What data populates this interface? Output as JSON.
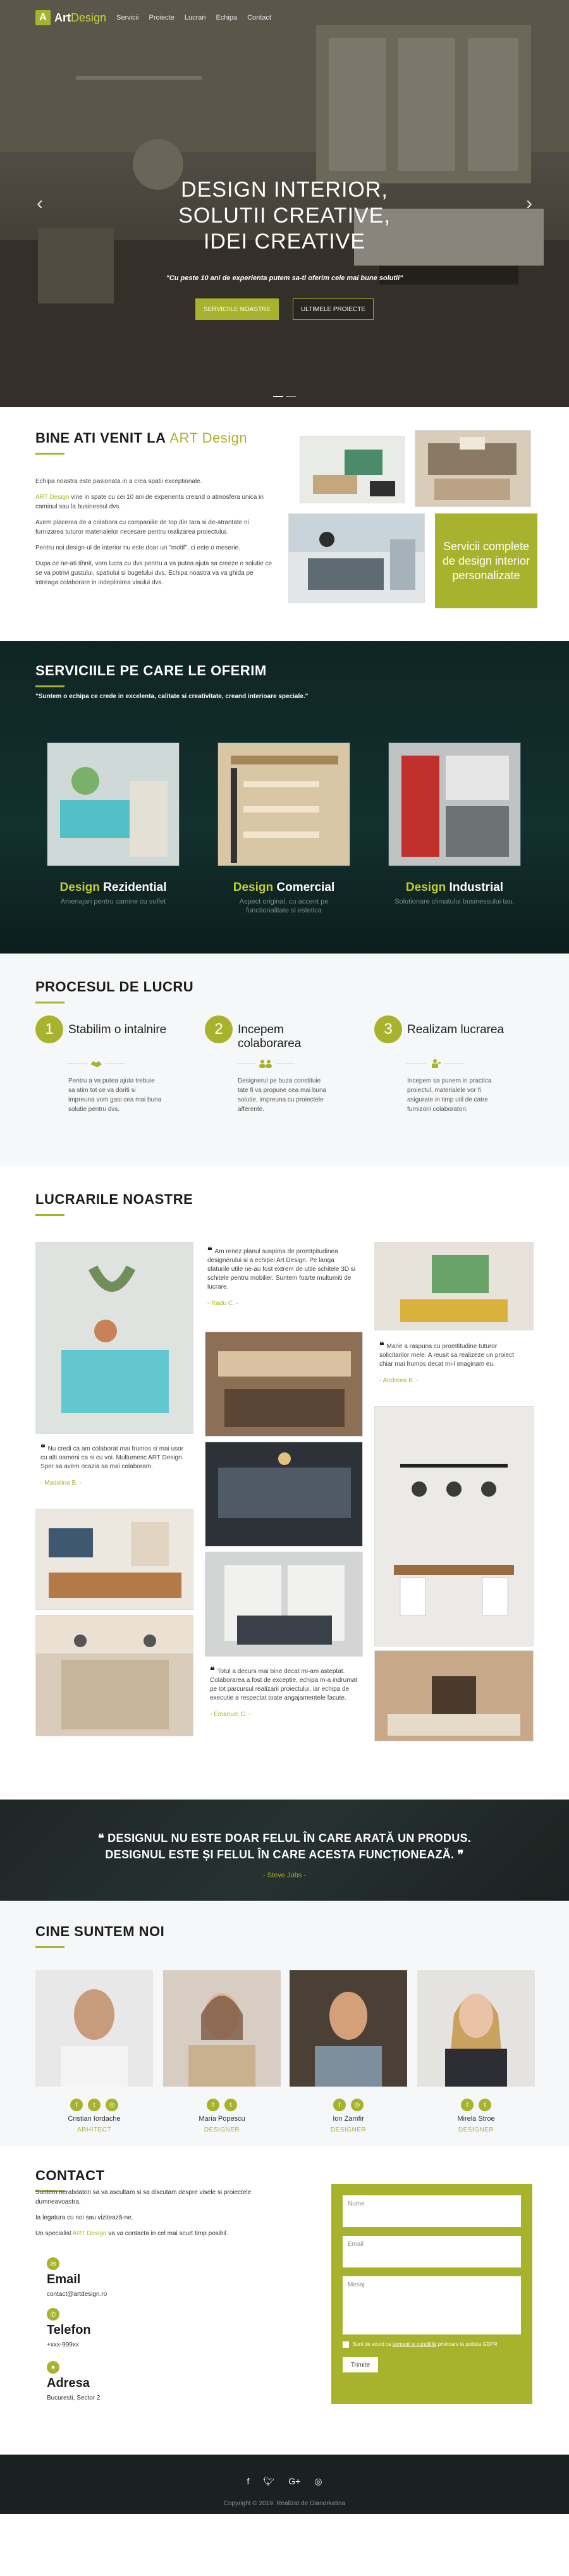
{
  "brand": {
    "part1": "Art",
    "part2": "Design",
    "mark": "A"
  },
  "nav": [
    "Servicii",
    "Proiecte",
    "Lucrari",
    "Echipa",
    "Contact"
  ],
  "hero": {
    "title_l1": "DESIGN INTERIOR,",
    "title_l2": "SOLUTII CREATIVE,",
    "title_l3": "IDEI CREATIVE",
    "subtitle": "\"Cu peste 10 ani de experienta putem sa-ti oferim cele mai bune solutii\"",
    "btn1": "SERVICIILE NOASTRE",
    "btn2": "ULTIMELE PROIECTE",
    "prev": "‹",
    "next": "›"
  },
  "welcome": {
    "title_a": "BINE ATI VENIT LA ",
    "title_b": "ART Design",
    "p1": "Echipa noastra este pasionata in a crea spatii exceptionale.",
    "p2_brand": "ART Design",
    "p2": " vine in spate cu cei 10 ani de experienta creand o atmosfera unica in caminul sau la businessul dvs.",
    "p3": "Avem placerea de a colabora cu companiile de top din tara si de-atrantate ni furnizarea tuturor materialelor necesare pentru realizarea proiectului.",
    "p4": "Pentru noi design-ul de interior nu este doar un \"motif\", ci este o meserie.",
    "p5": "Dupa ce ne-ati tihnit, vom lucra cu dvs pentru a va putea ajuta sa creeze o solutie ce se va potrivi gustului, spatiului si bugetului dvs. Echipa noastra va va ghida pe intreaga colaborare in indeplinirea visului dvs.",
    "cta": "Servicii complete de design interior personalizate"
  },
  "services": {
    "title": "SERVICIILE PE CARE LE OFERIM",
    "quote": "\"Suntem o echipa ce crede in excelenta, calitate si creativitate, creand interioare speciale.\"",
    "items": [
      {
        "a": "Design",
        "b": " Rezidential",
        "desc": "Amenajari pentru camine cu suflet"
      },
      {
        "a": "Design",
        "b": " Comercial",
        "desc": "Aspect original, cu accent pe functionalitate si estetica"
      },
      {
        "a": "Design",
        "b": " Industrial",
        "desc": "Solutionare climatului businessului tau."
      }
    ]
  },
  "process": {
    "title": "PROCESUL DE LUCRU",
    "steps": [
      {
        "n": "1",
        "t": "Stabilim o intalnire",
        "d": "Pentru a va putea ajuta trebuie sa stim tot ce va doriti si impreuna vom gasi cea mai buna solutie pentru dvs."
      },
      {
        "n": "2",
        "t": "Incepem colaborarea",
        "d": "Designerul pe buza constituie tate fi va propune cea mai buna solutie, impreuna cu proiectele afferente."
      },
      {
        "n": "3",
        "t": "Realizam lucrarea",
        "d": "Incepem sa punem in practica proiectul, materialele vor fi asigurate in timp util de catre furnizorii colaboratori."
      }
    ]
  },
  "works": {
    "title": "LUCRARILE NOASTRE",
    "quotes": [
      {
        "q": "Am renez planul suspima de promtpitudinea designerului si a echipei Art Design. Pe langa sfaturile utile ne-au fost extrem de utile schitele 3D si schitele pentru mobilier. Suntem foarte multumiti de lucrare.",
        "who": "- Radu C. -"
      },
      {
        "q": "Marie a raspuns cu promtitudine tuturor solicitarilor mele. A reusit sa realizeze un proiect chiar mai frumos decat mi-l imaginam eu.",
        "who": "- Andreea B. -"
      },
      {
        "q": "Nu credi ca am colaborat mai frumos si mai usor cu alti oameni ca si cu voi. Multumesc ART Design. Sper sa avem ocazia sa mai colaboram.",
        "who": "- Madalina B. -"
      },
      {
        "q": "Totul a decurs mai bine decat mi-am asteptat. Colaborarea a fost de exceptie, echipa m-a indrumat pe tot parcursul realizarii proiectului, iar echipa de executie a respectat toate angajamentele facute.",
        "who": "- Emanuel C. -"
      }
    ]
  },
  "banner": {
    "q1": "DESIGNUL NU ESTE DOAR FELUL ÎN CARE ARATĂ UN PRODUS.",
    "q2": "DESIGNUL ESTE ȘI FELUL ÎN CARE ACESTA FUNCȚIONEAZĂ.",
    "author": "- Steve Jobs -"
  },
  "team": {
    "title": "CINE SUNTEM NOI",
    "members": [
      {
        "n": "Cristian Iordache",
        "r": "ARHITECT"
      },
      {
        "n": "Maria Popescu",
        "r": "DESIGNER"
      },
      {
        "n": "Ion Zamfir",
        "r": "DESIGNER"
      },
      {
        "n": "Mirela Stroe",
        "r": "DESIGNER"
      }
    ]
  },
  "contact": {
    "title": "CONTACT",
    "p1": "Suntem nerabdatori sa va ascultam si sa discutam despre visele si proiectele dumneavoastra.",
    "p2": "Ia legatura cu noi sau vizitează-ne.",
    "p3a": "Un specialist ",
    "p3b": "ART Design",
    "p3c": " va va contacta in cel mai scurt timp posibil.",
    "email_label": "Email",
    "email": "contact@artdesign.ro",
    "phone_label": "Telefon",
    "phone": "+xxx-999xx",
    "address_label": "Adresa",
    "address": "Bucuresti, Sector 2",
    "form_name": "Nume",
    "form_email": "Email",
    "form_msg": "Mesaj",
    "agree_a": "Sunt de acord ca ",
    "agree_link": "termenii si conditiile",
    "agree_b": " privitoare la politica GDPR",
    "send": "Trimite"
  },
  "footer": {
    "copy": "Copyright © 2019. Realizat de  Dianorkatina"
  },
  "colors": {
    "accent": "#a8b32d",
    "dark": "#12302e"
  }
}
